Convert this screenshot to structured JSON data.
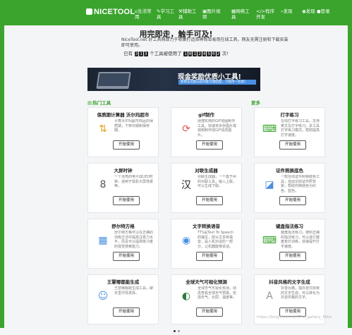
{
  "header": {
    "logo": "NICETOOL",
    "nav": [
      {
        "icon": "home-icon",
        "glyph": "⌂",
        "label": "生活常用"
      },
      {
        "icon": "study-icon",
        "glyph": "✎",
        "label": "学习工具"
      },
      {
        "icon": "tools-icon",
        "glyph": "⚒",
        "label": "辅助工具"
      },
      {
        "icon": "image-icon",
        "glyph": "▣",
        "label": "图片视频"
      },
      {
        "icon": "grid-icon",
        "glyph": "▦",
        "label": "网络工具"
      },
      {
        "icon": "code-icon",
        "glyph": "</>",
        "label": "程序开发"
      },
      {
        "icon": "search-icon",
        "glyph": "⌕",
        "label": "发现"
      },
      {
        "icon": "compass-icon",
        "glyph": "◉",
        "label": "发现"
      },
      {
        "icon": "user-icon",
        "glyph": "●",
        "label": "登录"
      }
    ]
  },
  "hero": {
    "title": "用完即走，触手可及!",
    "subtitle": "NiceTool.net 好工具网致力于收集打造各种简单易用在线工具，网友无需注册和下载安装即可使用。",
    "counter_prefix": "已有",
    "counter_a": "313",
    "counter_mid": "个工具被使用了",
    "counter_b": "10124502",
    "counter_suffix": "次!"
  },
  "banner": {
    "title": "现金奖励优质小工具!",
    "tag": "新想法可能与您的能力相匹配，小程序一比如！"
  },
  "section": {
    "title": "热门工具",
    "more": "更多"
  },
  "button_label": "开始使用",
  "tools": [
    {
      "name": "保质期计算器 沃尔玛超市",
      "icon": "arrows-icon",
      "glyph": "⇅",
      "color": "#e3a21a",
      "desc": "计算沃尔玛超市商品的保质期，下架日期和保存期。"
    },
    {
      "name": "gif制作",
      "icon": "gif-icon",
      "glyph": "⟳",
      "color": "#e35252",
      "desc": "便捷实用的GIF动图制作工具，快速将多张图片或视频制作成GIF动态图片。"
    },
    {
      "name": "打字练习",
      "icon": "keyboard-icon",
      "glyph": "⌨",
      "color": "#3aa42d",
      "desc": "在线打字练习工具，支持英文及打字练习。本工具打字练习模式，帮助提高打字速度。"
    },
    {
      "name": "大屏时钟",
      "icon": "clock-icon",
      "glyph": "8",
      "color": "#555",
      "desc": "一个漂亮的电子屏LED时钟，适用于投影大屏场景等。"
    },
    {
      "name": "对联生成器",
      "icon": "chinese-char-icon",
      "glyph": "汉",
      "color": "#222",
      "desc": "对联生成器，一个基于AI的对联工具，输入上联，可以生成下联。"
    },
    {
      "name": "证件照换底色",
      "icon": "id-photo-icon",
      "glyph": "◪",
      "color": "#4a90e2",
      "desc": "一款在线证件照换底色工具，自动识别证件照背景，帮助你换底色为红色、蓝色。"
    },
    {
      "name": "舒尔特方格",
      "icon": "grid-icon",
      "glyph": "▦",
      "color": "#4a90e2",
      "desc": "舒尔特方格可以在正确的训练方法中提高注意力水平，而且可以提高练习者的视觉搜索能力。"
    },
    {
      "name": "文字转换语音",
      "icon": "speaker-icon",
      "glyph": "◉",
      "color": "#4a90e2",
      "desc": "TTS是Text To Speech的缩写，即从文本到语音，是人机对话的一部分，让机器能够说话。"
    },
    {
      "name": "键盘指法练习",
      "icon": "keyboard-icon",
      "glyph": "⌨",
      "color": "#3aa42d",
      "desc": "键盘指法练习，按照正确的指法练习，可以进行键盘盲打训练，快速提升打字速度。"
    },
    {
      "name": "王慧哪都能生成",
      "icon": "face-icon",
      "glyph": "☺",
      "color": "#4a90e2",
      "desc": "王慧哪都能生成工具，聊天里尽情发挥。"
    },
    {
      "name": "全球天气可视化预测",
      "icon": "globe-icon",
      "glyph": "◐",
      "color": "#2a7a3a",
      "desc": "全球天气可视化预测，动态查看全球天气预报，包括天气、云层、温度等。"
    },
    {
      "name": "抖音风格的文字生成",
      "icon": "text-style-icon",
      "glyph": "A",
      "color": "#999",
      "desc": "抖音风格，指抖音式效果的文字生成，可以转化为抖音风格的文字。"
    }
  ],
  "watermark": "https://blog.csdn.net/The_gallery_Mike"
}
